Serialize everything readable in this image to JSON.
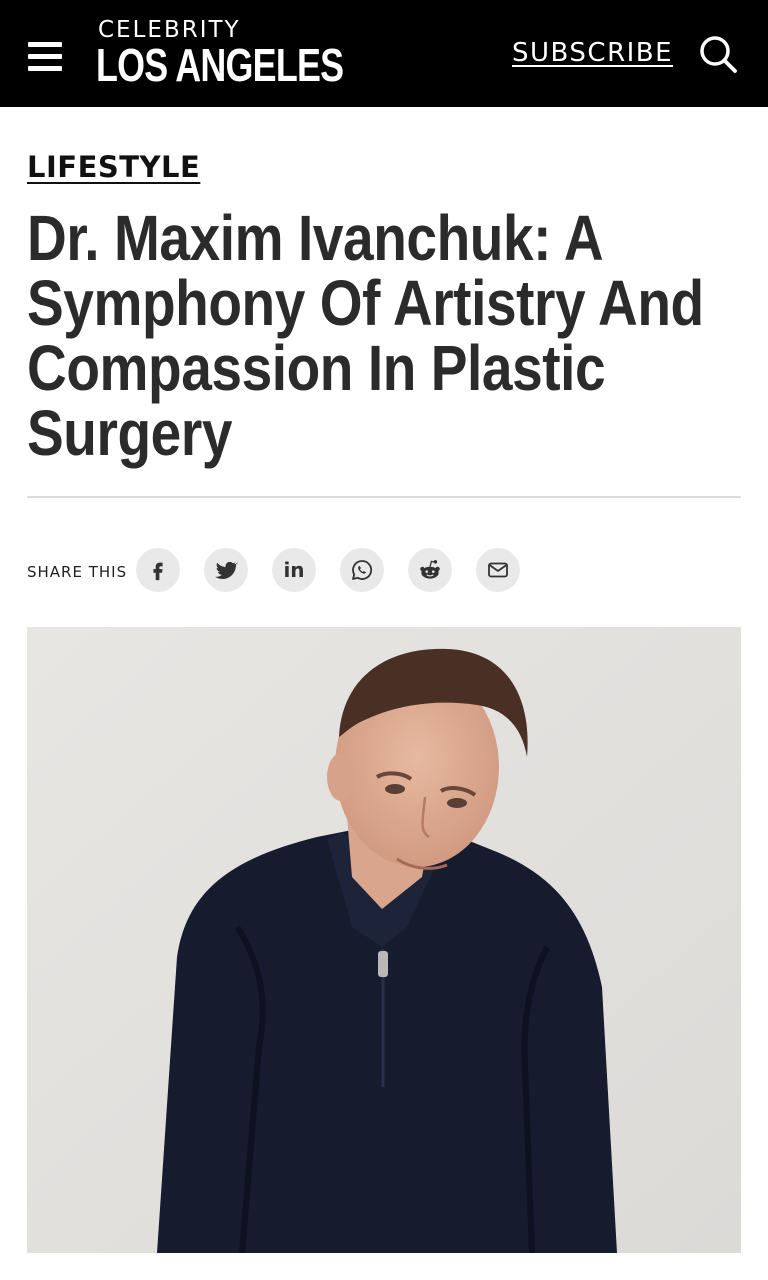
{
  "header": {
    "logo_top": "CELEBRITY",
    "logo_bottom": "LOS ANGELES",
    "subscribe_label": "SUBSCRIBE",
    "menu_icon": "hamburger-menu-icon",
    "search_icon": "search-icon",
    "background_color": "#000000"
  },
  "article": {
    "category": "LIFESTYLE",
    "headline": "Dr. Maxim Ivanchuk: A Symphony Of Artistry And Compassion In Plastic Surgery"
  },
  "share": {
    "label": "SHARE THIS",
    "buttons": [
      {
        "icon": "facebook-icon"
      },
      {
        "icon": "twitter-icon"
      },
      {
        "icon": "linkedin-icon",
        "text": "in"
      },
      {
        "icon": "whatsapp-icon"
      },
      {
        "icon": "reddit-icon"
      },
      {
        "icon": "email-icon"
      }
    ]
  },
  "hero_image": {
    "subject": "portrait",
    "background_color": "#e6e4e1",
    "shirt_color": "#161b2e"
  }
}
